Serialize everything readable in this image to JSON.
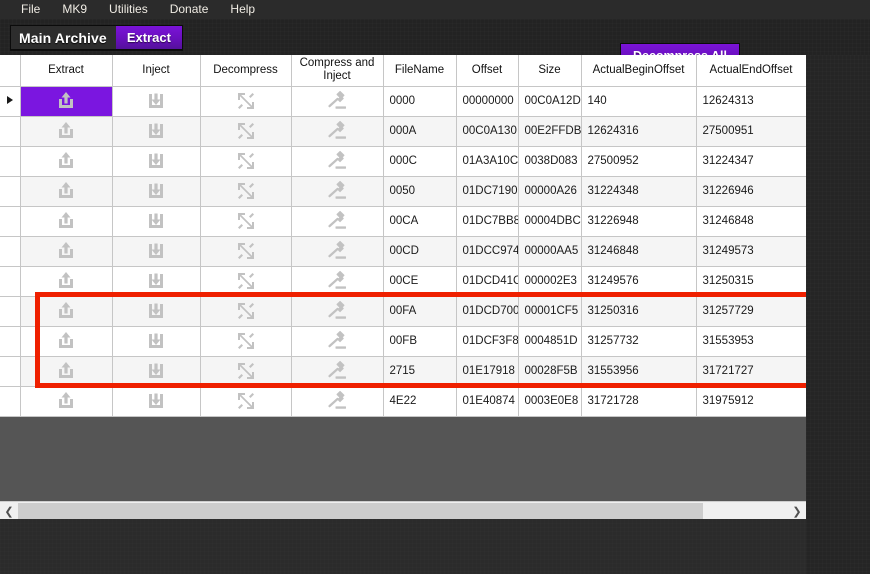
{
  "menubar": {
    "items": [
      {
        "label": "File",
        "name": "menu-file"
      },
      {
        "label": "MK9",
        "name": "menu-mk9"
      },
      {
        "label": "Utilities",
        "name": "menu-utilities"
      },
      {
        "label": "Donate",
        "name": "menu-donate"
      },
      {
        "label": "Help",
        "name": "menu-help"
      }
    ]
  },
  "toolbar": {
    "archive_label": "Main Archive",
    "extract_label": "Extract",
    "decompress_all_label": "Decompress All",
    "accent_color": "#7b16e0",
    "highlight_color": "#ef2000"
  },
  "grid": {
    "columns": [
      {
        "label": "",
        "name": "column-row-selector",
        "kind": "selector"
      },
      {
        "label": "Extract",
        "name": "column-extract",
        "kind": "icon",
        "icon": "upload-icon"
      },
      {
        "label": "Inject",
        "name": "column-inject",
        "kind": "icon",
        "icon": "download-icon"
      },
      {
        "label": "Decompress",
        "name": "column-decompress",
        "kind": "icon",
        "icon": "expand-arrows-icon"
      },
      {
        "label": "Compress and Inject",
        "name": "column-compress-and-inject",
        "kind": "icon",
        "icon": "gavel-icon"
      },
      {
        "label": "FileName",
        "name": "column-filename",
        "kind": "text"
      },
      {
        "label": "Offset",
        "name": "column-offset",
        "kind": "text"
      },
      {
        "label": "Size",
        "name": "column-size",
        "kind": "text"
      },
      {
        "label": "ActualBeginOffset",
        "name": "column-actualbeginoffset",
        "kind": "text"
      },
      {
        "label": "ActualEndOffset",
        "name": "column-actualendoffset",
        "kind": "text"
      }
    ],
    "rows": [
      {
        "selected": true,
        "filename": "0000",
        "offset": "00000000",
        "size": "00C0A12D",
        "begin": "140",
        "end": "12624313"
      },
      {
        "selected": false,
        "filename": "000A",
        "offset": "00C0A130",
        "size": "00E2FFDB",
        "begin": "12624316",
        "end": "27500951"
      },
      {
        "selected": false,
        "filename": "000C",
        "offset": "01A3A10C",
        "size": "0038D083",
        "begin": "27500952",
        "end": "31224347"
      },
      {
        "selected": false,
        "filename": "0050",
        "offset": "01DC7190",
        "size": "00000A26",
        "begin": "31224348",
        "end": "31226946"
      },
      {
        "selected": false,
        "filename": "00CA",
        "offset": "01DC7BB8",
        "size": "00004DBC",
        "begin": "31226948",
        "end": "31246848"
      },
      {
        "selected": false,
        "filename": "00CD",
        "offset": "01DCC974",
        "size": "00000AA5",
        "begin": "31246848",
        "end": "31249573"
      },
      {
        "selected": false,
        "filename": "00CE",
        "offset": "01DCD41C",
        "size": "000002E3",
        "begin": "31249576",
        "end": "31250315"
      },
      {
        "selected": false,
        "filename": "00FA",
        "offset": "01DCD700",
        "size": "00001CF5",
        "begin": "31250316",
        "end": "31257729"
      },
      {
        "selected": false,
        "filename": "00FB",
        "offset": "01DCF3F8",
        "size": "0004851D",
        "begin": "31257732",
        "end": "31553953"
      },
      {
        "selected": false,
        "filename": "2715",
        "offset": "01E17918",
        "size": "00028F5B",
        "begin": "31553956",
        "end": "31721727"
      },
      {
        "selected": false,
        "filename": "4E22",
        "offset": "01E40874",
        "size": "0003E0E8",
        "begin": "31721728",
        "end": "31975912"
      }
    ],
    "selected_row_index": 0,
    "highlighted_row_indices": [
      7,
      8,
      9
    ]
  },
  "scrollbar": {
    "left_arrow": "❮",
    "right_arrow": "❯"
  }
}
